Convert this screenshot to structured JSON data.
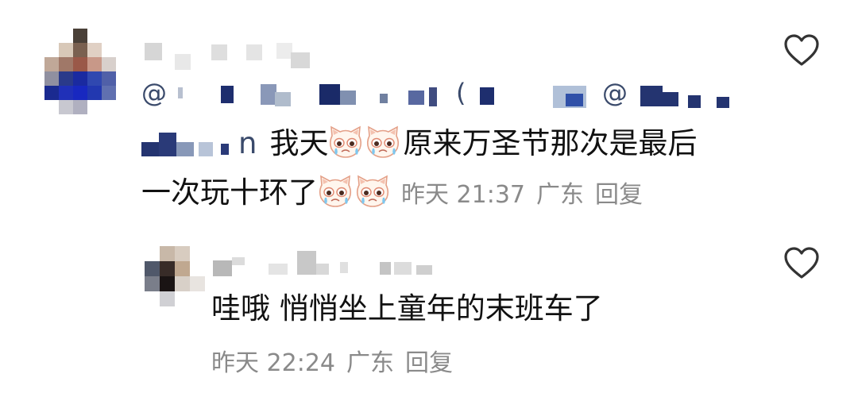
{
  "comment": {
    "mention_prefix": "@",
    "mention_second": "@",
    "mention_tail": "n",
    "text_line1": "我天",
    "text_line1b": "原来万圣节那次是最后",
    "text_line2": "一次玩十环了",
    "time": "昨天 21:37",
    "location": "广东",
    "reply_label": "回复",
    "emoji_name": "crying-cat-face"
  },
  "reply": {
    "text": "哇哦 悄悄坐上童年的末班车了",
    "time": "昨天 22:24",
    "location": "广东",
    "reply_label": "回复"
  },
  "icons": {
    "like_icon": "heart-outline-icon"
  },
  "colors": {
    "text": "#111111",
    "meta": "#8a8a8a",
    "mention": "#3a4a6b",
    "heart_stroke": "#333333"
  }
}
